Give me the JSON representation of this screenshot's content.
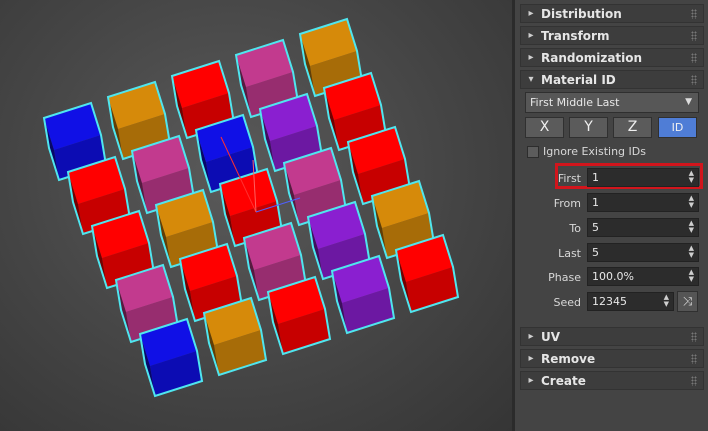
{
  "rollouts": {
    "distribution": "Distribution",
    "transform": "Transform",
    "randomization": "Randomization",
    "material_id": "Material ID",
    "uv": "UV",
    "remove": "Remove",
    "create": "Create"
  },
  "signs": {
    "collapsed": "▸",
    "expanded": "▾"
  },
  "material": {
    "mode": "First Middle Last",
    "axes": [
      "X",
      "Y",
      "Z",
      "ID"
    ],
    "active_axis": "ID",
    "ignore_label": "Ignore Existing IDs",
    "ignore_checked": false,
    "fields": {
      "first": {
        "label": "First",
        "value": "1"
      },
      "from": {
        "label": "From",
        "value": "1"
      },
      "to": {
        "label": "To",
        "value": "5"
      },
      "last": {
        "label": "Last",
        "value": "5"
      },
      "phase": {
        "label": "Phase",
        "value": "100.0%"
      },
      "seed": {
        "label": "Seed",
        "value": "12345"
      }
    }
  },
  "icons": {
    "dropdown_arrow": "▼",
    "spinner_arrows": "▲▼",
    "shuffle": "⤨"
  },
  "colors": {
    "blue": "#1010e6",
    "orange": "#d68a0a",
    "red": "#ff0000",
    "pink": "#c23a8e",
    "purple": "#8a1fd0",
    "selection_outline": "#4fe6ef",
    "highlight": "#d2151c",
    "active_button": "#4f7dd6"
  },
  "cube_grid_colors": [
    [
      "blue",
      "red",
      "red",
      "pink",
      "blue"
    ],
    [
      "orange",
      "pink",
      "orange",
      "red",
      "orange"
    ],
    [
      "red",
      "blue",
      "red",
      "pink",
      "red"
    ],
    [
      "pink",
      "purple",
      "pink",
      "purple",
      "purple"
    ],
    [
      "orange",
      "red",
      "red",
      "orange",
      "red"
    ]
  ]
}
